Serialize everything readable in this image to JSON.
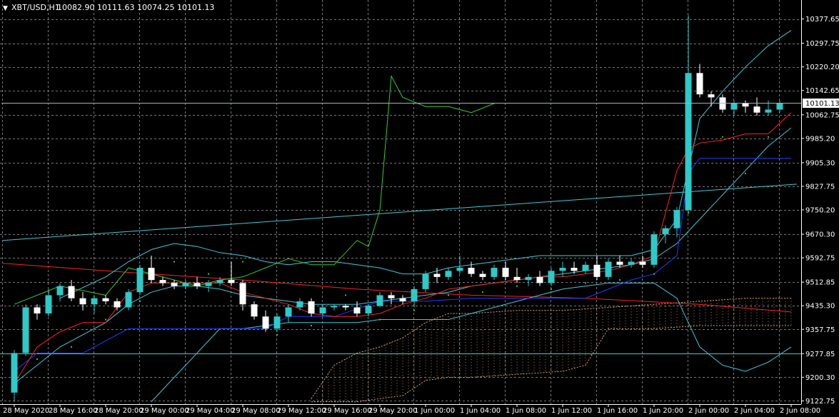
{
  "header": {
    "symbol": "XBT/USD,H1",
    "ohlc": "10082.90 10111.63 10074.25 10101.13"
  },
  "colors": {
    "background": "#000000",
    "grid": "#a0a0a0",
    "bull_candle": "#2ec9c9",
    "bear_candle": "#ffffff",
    "bollinger": "#40c8d8",
    "tenkan": "#ff2020",
    "kijun": "#1f3cff",
    "chikou": "#34cc34",
    "kumo": "#d9a070",
    "trendline": "#40c8d8",
    "sma": "#ff2020",
    "psar": "#34cc34",
    "price_line": "#9ab7c0"
  },
  "chart_data": {
    "type": "candlestick",
    "instrument": "XBT/USD",
    "timeframe": "H1",
    "current_price": "10101.13",
    "ylim": [
      9112,
      10440
    ],
    "y_ticks": [
      "10377.65",
      "10297.75",
      "10220.20",
      "10142.65",
      "10062.75",
      "9985.20",
      "9905.30",
      "9827.75",
      "9750.20",
      "9670.30",
      "9592.75",
      "9512.85",
      "9435.30",
      "9357.75",
      "9277.85",
      "9200.30",
      "9122.75"
    ],
    "y_tick_values": [
      10377.65,
      10297.75,
      10220.2,
      10142.65,
      10062.75,
      9985.2,
      9905.3,
      9827.75,
      9750.2,
      9670.3,
      9592.75,
      9512.85,
      9435.3,
      9357.75,
      9277.85,
      9200.3,
      9122.75
    ],
    "x_labels": [
      "28 May 2020",
      "28 May 16:00",
      "28 May 20:00",
      "29 May 00:00",
      "29 May 04:00",
      "29 May 08:00",
      "29 May 12:00",
      "29 May 16:00",
      "29 May 20:00",
      "1 Jun 00:00",
      "1 Jun 04:00",
      "1 Jun 08:00",
      "1 Jun 12:00",
      "1 Jun 16:00",
      "1 Jun 20:00",
      "2 Jun 00:00",
      "2 Jun 04:00",
      "2 Jun 08:00"
    ],
    "x_label_bars": [
      0,
      4,
      8,
      12,
      16,
      20,
      24,
      28,
      32,
      36,
      40,
      44,
      48,
      52,
      56,
      60,
      64,
      68
    ],
    "ohlc": [
      [
        9150,
        9290,
        9120,
        9280
      ],
      [
        9280,
        9440,
        9270,
        9430
      ],
      [
        9430,
        9440,
        9390,
        9410
      ],
      [
        9410,
        9490,
        9400,
        9470
      ],
      [
        9470,
        9510,
        9450,
        9500
      ],
      [
        9500,
        9520,
        9450,
        9460
      ],
      [
        9460,
        9480,
        9420,
        9440
      ],
      [
        9440,
        9470,
        9410,
        9460
      ],
      [
        9460,
        9470,
        9440,
        9450
      ],
      [
        9450,
        9460,
        9420,
        9430
      ],
      [
        9430,
        9490,
        9420,
        9480
      ],
      [
        9480,
        9570,
        9470,
        9560
      ],
      [
        9560,
        9600,
        9510,
        9520
      ],
      [
        9520,
        9530,
        9500,
        9510
      ],
      [
        9510,
        9520,
        9490,
        9500
      ],
      [
        9500,
        9520,
        9490,
        9510
      ],
      [
        9510,
        9530,
        9490,
        9500
      ],
      [
        9500,
        9520,
        9480,
        9510
      ],
      [
        9510,
        9530,
        9500,
        9520
      ],
      [
        9520,
        9580,
        9500,
        9510
      ],
      [
        9510,
        9520,
        9420,
        9440
      ],
      [
        9440,
        9450,
        9390,
        9400
      ],
      [
        9400,
        9420,
        9350,
        9360
      ],
      [
        9360,
        9410,
        9350,
        9400
      ],
      [
        9400,
        9440,
        9380,
        9430
      ],
      [
        9430,
        9460,
        9420,
        9450
      ],
      [
        9450,
        9460,
        9400,
        9410
      ],
      [
        9410,
        9440,
        9400,
        9430
      ],
      [
        9430,
        9440,
        9420,
        9435
      ],
      [
        9435,
        9440,
        9420,
        9430
      ],
      [
        9430,
        9450,
        9400,
        9410
      ],
      [
        9410,
        9440,
        9400,
        9435
      ],
      [
        9435,
        9480,
        9430,
        9470
      ],
      [
        9470,
        9480,
        9440,
        9460
      ],
      [
        9460,
        9470,
        9440,
        9450
      ],
      [
        9450,
        9500,
        9430,
        9490
      ],
      [
        9490,
        9550,
        9480,
        9540
      ],
      [
        9540,
        9560,
        9510,
        9530
      ],
      [
        9530,
        9560,
        9520,
        9550
      ],
      [
        9550,
        9600,
        9540,
        9560
      ],
      [
        9560,
        9580,
        9530,
        9540
      ],
      [
        9540,
        9550,
        9520,
        9530
      ],
      [
        9530,
        9570,
        9520,
        9560
      ],
      [
        9560,
        9580,
        9520,
        9530
      ],
      [
        9530,
        9560,
        9510,
        9520
      ],
      [
        9520,
        9540,
        9500,
        9530
      ],
      [
        9530,
        9550,
        9500,
        9510
      ],
      [
        9510,
        9560,
        9500,
        9550
      ],
      [
        9550,
        9580,
        9530,
        9560
      ],
      [
        9560,
        9580,
        9540,
        9550
      ],
      [
        9550,
        9580,
        9540,
        9570
      ],
      [
        9570,
        9600,
        9520,
        9530
      ],
      [
        9530,
        9590,
        9520,
        9580
      ],
      [
        9580,
        9600,
        9560,
        9570
      ],
      [
        9570,
        9590,
        9560,
        9580
      ],
      [
        9580,
        9600,
        9560,
        9570
      ],
      [
        9570,
        9680,
        9560,
        9670
      ],
      [
        9670,
        9700,
        9640,
        9690
      ],
      [
        9690,
        9760,
        9660,
        9750
      ],
      [
        9750,
        10390,
        9740,
        10200
      ],
      [
        10200,
        10230,
        10120,
        10130
      ],
      [
        10130,
        10140,
        10090,
        10120
      ],
      [
        10120,
        10130,
        10070,
        10080
      ],
      [
        10080,
        10110,
        10060,
        10100
      ],
      [
        10100,
        10110,
        10070,
        10090
      ],
      [
        10090,
        10120,
        10060,
        10070
      ],
      [
        10070,
        10110,
        10060,
        10080
      ],
      [
        10080,
        10110,
        10070,
        10100
      ]
    ],
    "bollinger_upper": [
      [
        4,
        9460
      ],
      [
        8,
        9530
      ],
      [
        10,
        9580
      ],
      [
        12,
        9620
      ],
      [
        14,
        9640
      ],
      [
        16,
        9630
      ],
      [
        18,
        9610
      ],
      [
        20,
        9600
      ],
      [
        22,
        9580
      ],
      [
        24,
        9570
      ],
      [
        26,
        9580
      ],
      [
        28,
        9580
      ],
      [
        30,
        9570
      ],
      [
        32,
        9560
      ],
      [
        34,
        9540
      ],
      [
        36,
        9540
      ],
      [
        38,
        9560
      ],
      [
        40,
        9570
      ],
      [
        42,
        9580
      ],
      [
        44,
        9590
      ],
      [
        46,
        9600
      ],
      [
        48,
        9600
      ],
      [
        50,
        9600
      ],
      [
        52,
        9600
      ],
      [
        54,
        9600
      ],
      [
        56,
        9620
      ],
      [
        58,
        9720
      ],
      [
        60,
        10050
      ],
      [
        62,
        10140
      ],
      [
        64,
        10220
      ],
      [
        66,
        10290
      ],
      [
        68,
        10340
      ]
    ],
    "bollinger_mid": [
      [
        0,
        9180
      ],
      [
        4,
        9300
      ],
      [
        8,
        9380
      ],
      [
        10,
        9440
      ],
      [
        12,
        9480
      ],
      [
        14,
        9500
      ],
      [
        16,
        9500
      ],
      [
        18,
        9490
      ],
      [
        20,
        9470
      ],
      [
        22,
        9460
      ],
      [
        24,
        9450
      ],
      [
        26,
        9440
      ],
      [
        28,
        9440
      ],
      [
        30,
        9440
      ],
      [
        32,
        9450
      ],
      [
        34,
        9460
      ],
      [
        36,
        9470
      ],
      [
        38,
        9480
      ],
      [
        40,
        9500
      ],
      [
        42,
        9510
      ],
      [
        44,
        9520
      ],
      [
        46,
        9530
      ],
      [
        48,
        9540
      ],
      [
        50,
        9550
      ],
      [
        52,
        9560
      ],
      [
        54,
        9570
      ],
      [
        56,
        9590
      ],
      [
        58,
        9640
      ],
      [
        60,
        9720
      ],
      [
        62,
        9800
      ],
      [
        64,
        9880
      ],
      [
        66,
        9960
      ],
      [
        68,
        10020
      ]
    ],
    "bollinger_lower": [
      [
        12,
        9120
      ],
      [
        14,
        9200
      ],
      [
        16,
        9280
      ],
      [
        18,
        9360
      ],
      [
        20,
        9360
      ],
      [
        22,
        9370
      ],
      [
        24,
        9380
      ],
      [
        26,
        9380
      ],
      [
        28,
        9380
      ],
      [
        30,
        9380
      ],
      [
        32,
        9390
      ],
      [
        34,
        9390
      ],
      [
        36,
        9390
      ],
      [
        38,
        9390
      ],
      [
        40,
        9410
      ],
      [
        42,
        9430
      ],
      [
        44,
        9450
      ],
      [
        46,
        9470
      ],
      [
        48,
        9490
      ],
      [
        50,
        9500
      ],
      [
        52,
        9510
      ],
      [
        54,
        9510
      ],
      [
        56,
        9510
      ],
      [
        58,
        9460
      ],
      [
        60,
        9300
      ],
      [
        62,
        9240
      ],
      [
        64,
        9220
      ],
      [
        66,
        9250
      ],
      [
        68,
        9300
      ]
    ],
    "tenkan_sen": [
      [
        0,
        9180
      ],
      [
        2,
        9300
      ],
      [
        4,
        9350
      ],
      [
        6,
        9380
      ],
      [
        8,
        9380
      ],
      [
        10,
        9480
      ],
      [
        12,
        9510
      ],
      [
        14,
        9510
      ],
      [
        16,
        9510
      ],
      [
        18,
        9510
      ],
      [
        20,
        9480
      ],
      [
        22,
        9460
      ],
      [
        24,
        9440
      ],
      [
        26,
        9410
      ],
      [
        28,
        9400
      ],
      [
        30,
        9400
      ],
      [
        32,
        9410
      ],
      [
        34,
        9440
      ],
      [
        36,
        9460
      ],
      [
        38,
        9490
      ],
      [
        40,
        9500
      ],
      [
        42,
        9510
      ],
      [
        44,
        9520
      ],
      [
        46,
        9530
      ],
      [
        48,
        9530
      ],
      [
        50,
        9540
      ],
      [
        52,
        9550
      ],
      [
        54,
        9570
      ],
      [
        56,
        9600
      ],
      [
        58,
        9880
      ],
      [
        59,
        9950
      ],
      [
        60,
        9970
      ],
      [
        62,
        9980
      ],
      [
        64,
        10000
      ],
      [
        66,
        10000
      ],
      [
        68,
        10070
      ]
    ],
    "kijun_sen": [
      [
        0,
        9220
      ],
      [
        2,
        9280
      ],
      [
        6,
        9280
      ],
      [
        10,
        9360
      ],
      [
        14,
        9360
      ],
      [
        18,
        9360
      ],
      [
        22,
        9360
      ],
      [
        24,
        9400
      ],
      [
        28,
        9400
      ],
      [
        32,
        9450
      ],
      [
        36,
        9450
      ],
      [
        40,
        9460
      ],
      [
        44,
        9460
      ],
      [
        48,
        9460
      ],
      [
        50,
        9460
      ],
      [
        52,
        9490
      ],
      [
        54,
        9520
      ],
      [
        56,
        9540
      ],
      [
        58,
        9600
      ],
      [
        59,
        9870
      ],
      [
        60,
        9920
      ],
      [
        62,
        9920
      ],
      [
        64,
        9920
      ],
      [
        68,
        9920
      ]
    ],
    "chikou_span": [
      [
        0,
        9440
      ],
      [
        4,
        9500
      ],
      [
        8,
        9470
      ],
      [
        10,
        9560
      ],
      [
        12,
        9540
      ],
      [
        14,
        9520
      ],
      [
        16,
        9500
      ],
      [
        18,
        9520
      ],
      [
        20,
        9530
      ],
      [
        22,
        9560
      ],
      [
        24,
        9590
      ],
      [
        26,
        9570
      ],
      [
        28,
        9570
      ],
      [
        30,
        9650
      ],
      [
        31,
        9630
      ],
      [
        32,
        9750
      ],
      [
        33,
        10190
      ],
      [
        34,
        10120
      ],
      [
        36,
        10090
      ],
      [
        38,
        10090
      ],
      [
        40,
        10070
      ],
      [
        42,
        10100
      ]
    ],
    "senkou_span_a": [
      [
        26,
        9130
      ],
      [
        28,
        9240
      ],
      [
        30,
        9280
      ],
      [
        32,
        9300
      ],
      [
        34,
        9330
      ],
      [
        36,
        9380
      ],
      [
        38,
        9410
      ],
      [
        40,
        9410
      ],
      [
        44,
        9420
      ],
      [
        48,
        9420
      ],
      [
        52,
        9430
      ],
      [
        56,
        9440
      ],
      [
        60,
        9450
      ],
      [
        64,
        9460
      ],
      [
        68,
        9460
      ]
    ],
    "senkou_span_b": [
      [
        26,
        9120
      ],
      [
        28,
        9120
      ],
      [
        30,
        9120
      ],
      [
        32,
        9130
      ],
      [
        34,
        9140
      ],
      [
        36,
        9190
      ],
      [
        38,
        9200
      ],
      [
        40,
        9200
      ],
      [
        44,
        9210
      ],
      [
        48,
        9220
      ],
      [
        50,
        9240
      ],
      [
        52,
        9360
      ],
      [
        54,
        9360
      ],
      [
        56,
        9360
      ],
      [
        60,
        9370
      ],
      [
        64,
        9370
      ],
      [
        68,
        9370
      ]
    ],
    "sma_long": [
      [
        -1,
        9575
      ],
      [
        10,
        9545
      ],
      [
        20,
        9520
      ],
      [
        30,
        9490
      ],
      [
        40,
        9470
      ],
      [
        50,
        9460
      ],
      [
        60,
        9440
      ],
      [
        68,
        9415
      ]
    ],
    "trendline_1": [
      [
        -1,
        9650
      ],
      [
        68.5,
        9835
      ]
    ],
    "trendline_2_level": 9278,
    "psar": [
      [
        2,
        9260
      ],
      [
        5,
        9300
      ],
      [
        8,
        9390
      ],
      [
        11,
        9450
      ],
      [
        14,
        9580
      ],
      [
        17,
        9540
      ],
      [
        20,
        9580
      ],
      [
        23,
        9340
      ],
      [
        26,
        9370
      ],
      [
        29,
        9470
      ],
      [
        32,
        9390
      ],
      [
        35,
        9420
      ],
      [
        38,
        9470
      ],
      [
        41,
        9480
      ],
      [
        44,
        9500
      ],
      [
        47,
        9490
      ],
      [
        50,
        9510
      ],
      [
        53,
        9520
      ],
      [
        56,
        9540
      ],
      [
        59,
        9740
      ],
      [
        62,
        9990
      ],
      [
        64,
        9870
      ],
      [
        66,
        9990
      ]
    ]
  }
}
